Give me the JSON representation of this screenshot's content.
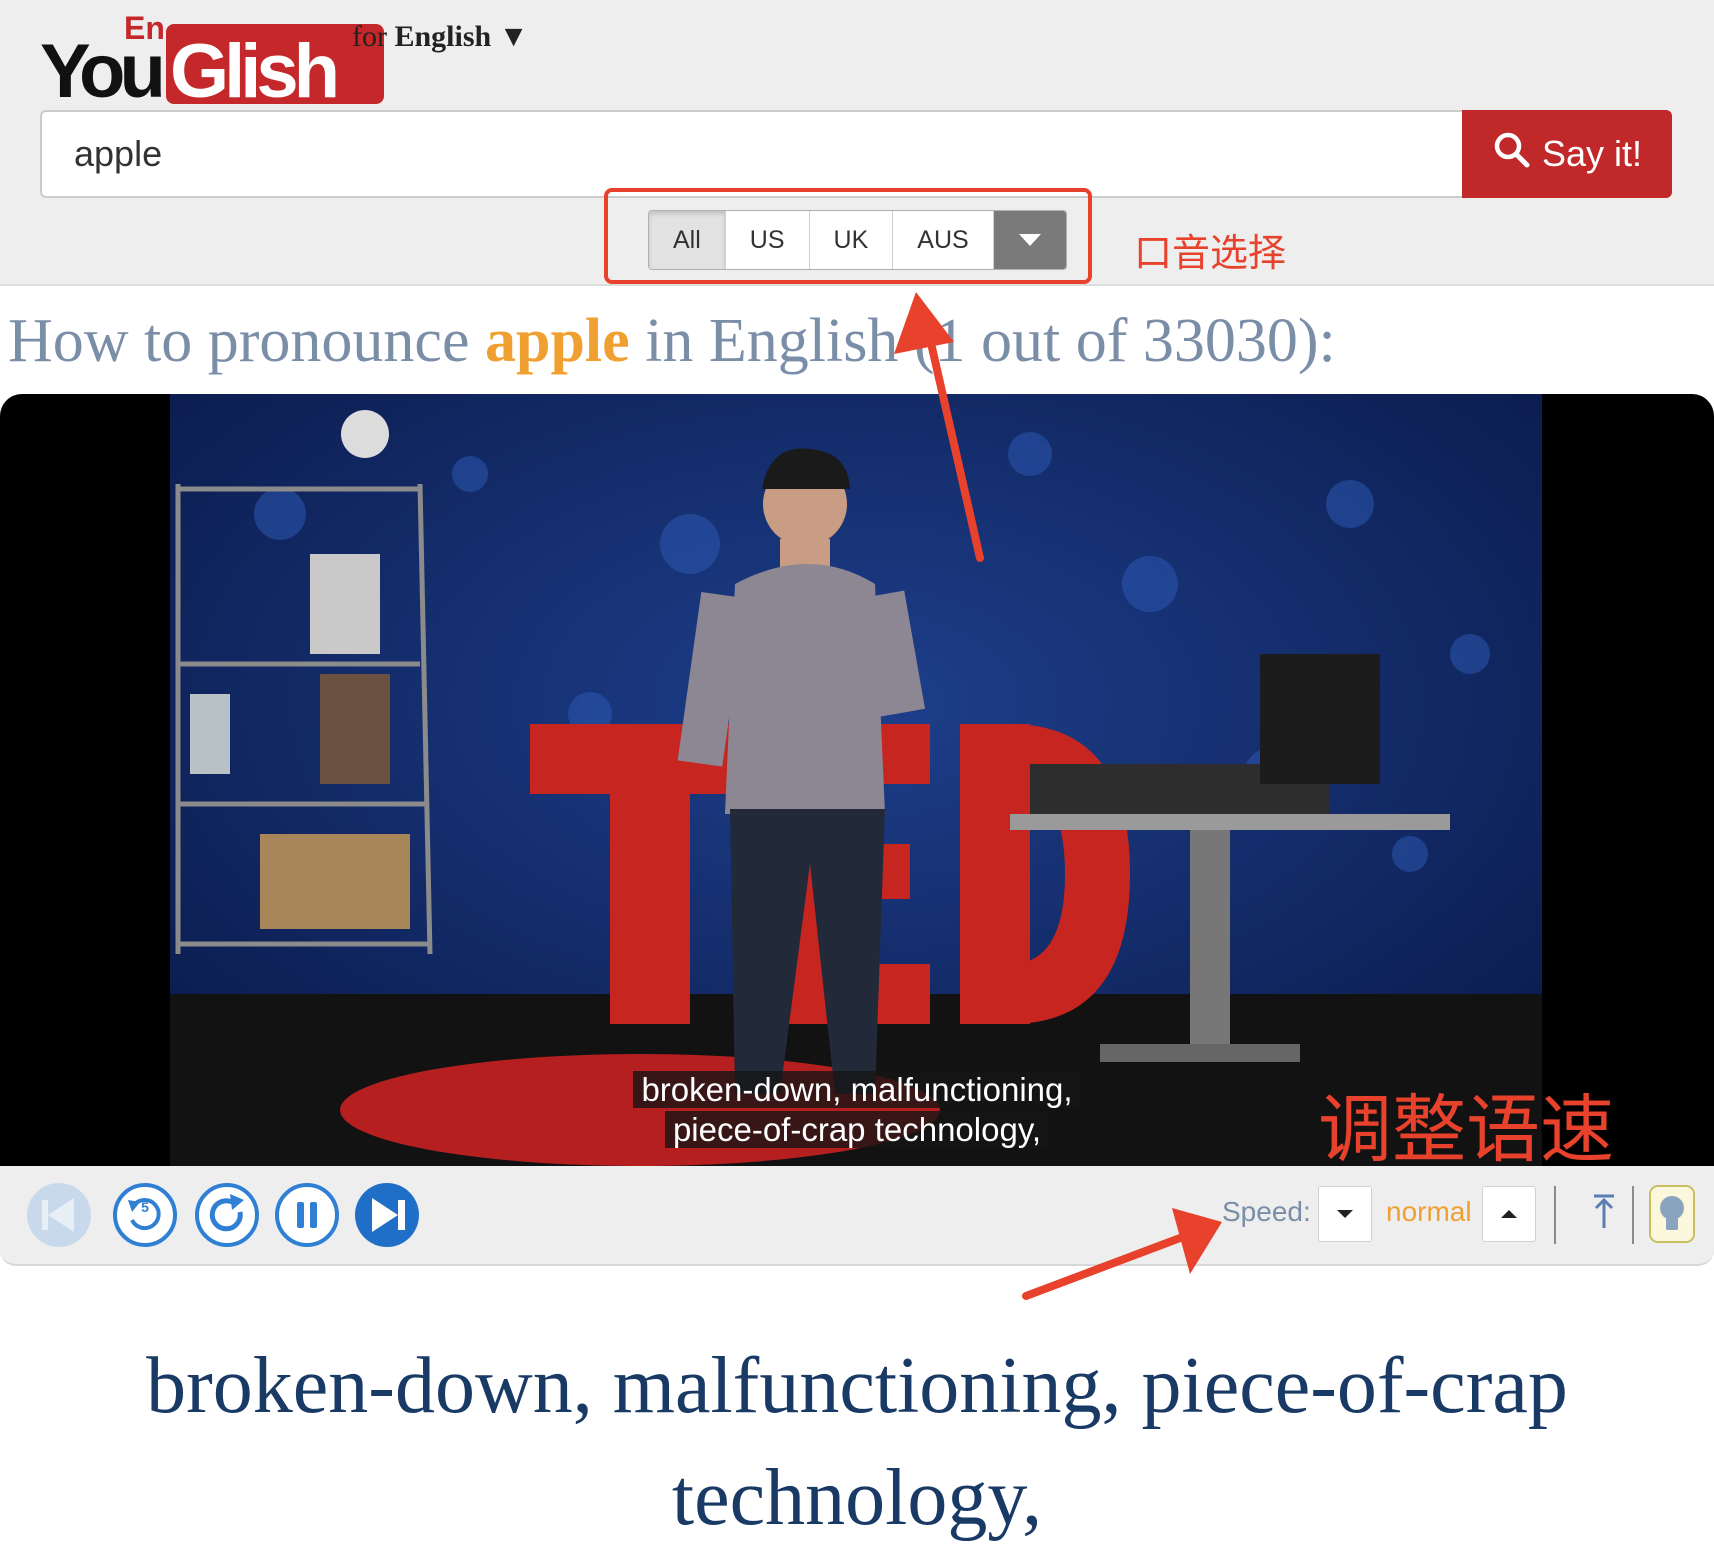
{
  "header": {
    "logo": {
      "en": "En",
      "you": "You",
      "glish": "Glish"
    },
    "lang_prefix": "for",
    "lang_name": "English",
    "lang_caret": "▼",
    "search": {
      "value": "apple"
    },
    "say_button": "Say it!"
  },
  "accents": {
    "options": [
      "All",
      "US",
      "UK",
      "AUS"
    ],
    "selected": "All"
  },
  "annotations": {
    "accent_select": "口音选择",
    "adjust_speed": "调整语速",
    "color": "#e8412c"
  },
  "title": {
    "prefix": "How to pronounce",
    "keyword": "apple",
    "suffix": "in English (1 out of 33030):"
  },
  "video": {
    "subtitle_line1": "broken-down, malfunctioning,",
    "subtitle_line2": "piece-of-crap technology,"
  },
  "controls": {
    "speed_label": "Speed:",
    "speed_value": "normal"
  },
  "caption": {
    "text": "broken-down, malfunctioning, piece-of-crap technology,"
  },
  "colors": {
    "brand_red": "#c5282a",
    "keyword_orange": "#f0a030",
    "title_gray": "#7b8ea8",
    "caption_navy": "#1a3a66",
    "control_blue": "#2f7fd4"
  }
}
